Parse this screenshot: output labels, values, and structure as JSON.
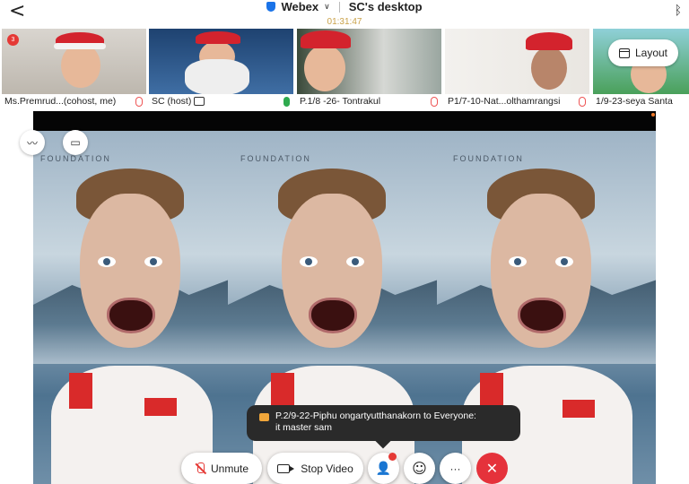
{
  "topbar": {
    "back_glyph": "<",
    "app_name": "Webex",
    "dropdown_glyph": "∨",
    "share_title": "SC's desktop",
    "timer": "01:31:47",
    "bluetooth_glyph": "ᛒ"
  },
  "participants": [
    {
      "label": "Ms.Premrud...(cohost, me)",
      "mic": "muted"
    },
    {
      "label": "SC (host)",
      "mic": "active"
    },
    {
      "label": "P.1/8 -26- Tontrakul",
      "mic": "muted"
    },
    {
      "label": "P1/7-10-Nat...olthamrangsi",
      "mic": "muted"
    },
    {
      "label": "1/9-23-seya Santa",
      "mic": "none"
    }
  ],
  "thumb_badge": "3",
  "layout_button": {
    "label": "Layout"
  },
  "video": {
    "foundation_text": "FOUNDATION"
  },
  "chat_toast": {
    "sender_line": "P.2/9-22-Piphu ongartyutthanakorn to Everyone:",
    "message": "it master sam"
  },
  "controls": {
    "unmute_label": "Unmute",
    "stop_video_label": "Stop Video",
    "more_glyph": "···",
    "end_glyph": "✕",
    "participants_glyph": "👤",
    "reaction_glyph": "☺"
  },
  "colors": {
    "accent": "#1a73e8",
    "end_call": "#e5323b",
    "muted": "#e53935",
    "active_mic": "#2eaa4e"
  }
}
